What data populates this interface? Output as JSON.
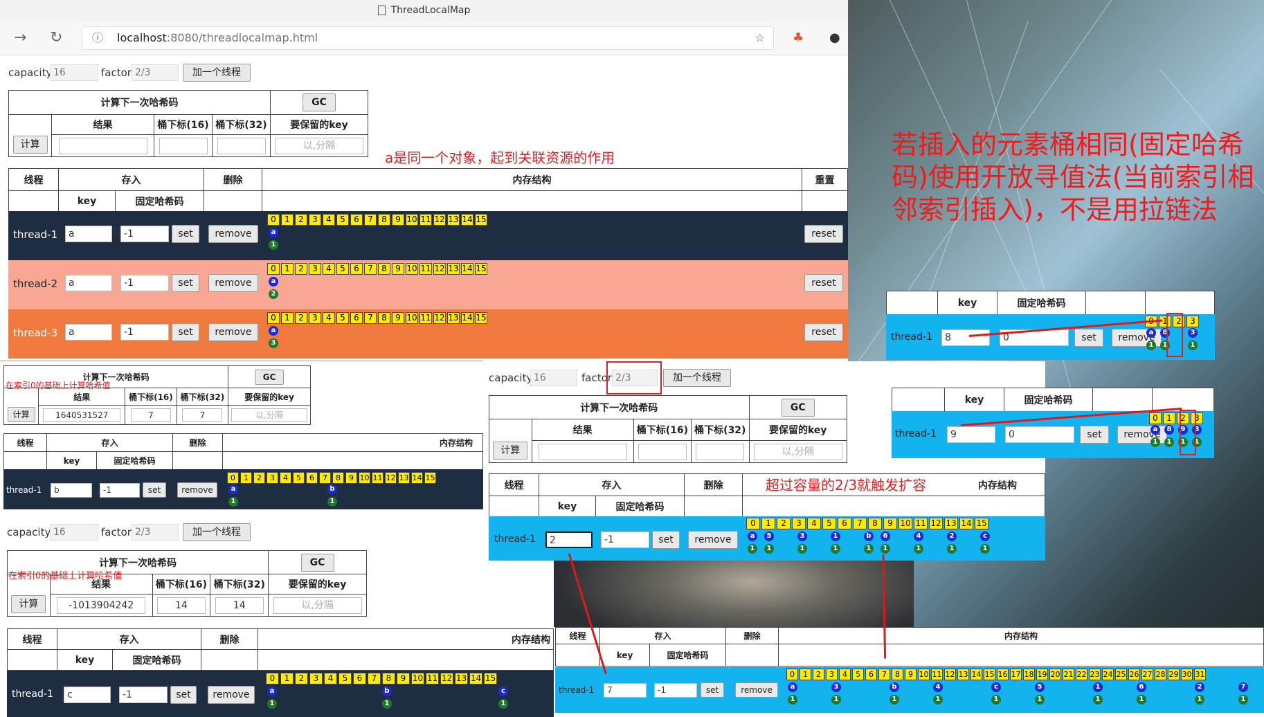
{
  "browser": {
    "tab_title": "ThreadLocalMap",
    "url_host": "localhost",
    "url_rest": ":8080/threadlocalmap.html"
  },
  "main": {
    "capacity_label": "capacity",
    "capacity_value": "16",
    "factor_label": "factor",
    "factor_value": "2/3",
    "add_thread_btn": "加一个线程",
    "calc_title": "计算下一次哈希码",
    "gc_btn": "GC",
    "result_label": "结果",
    "bucket16_label": "桶下标(16)",
    "bucket32_label": "桶下标(32)",
    "keep_key_label": "要保留的key",
    "calc_btn": "计算",
    "keep_placeholder": "以,分隔",
    "annotation": "a是同一个对象，起到关联资源的作用",
    "th_thread": "线程",
    "th_store": "存入",
    "th_delete": "删除",
    "th_memory": "内存结构",
    "th_reset": "重置",
    "th_key": "key",
    "th_fixed_hash": "固定哈希码",
    "set_btn": "set",
    "remove_btn": "remove",
    "reset_btn": "reset",
    "rows": [
      {
        "thread": "thread-1",
        "key": "a",
        "hash": "-1",
        "circle_key": "a",
        "circle_num": "1"
      },
      {
        "thread": "thread-2",
        "key": "a",
        "hash": "-1",
        "circle_key": "a",
        "circle_num": "2"
      },
      {
        "thread": "thread-3",
        "key": "a",
        "hash": "-1",
        "circle_key": "a",
        "circle_num": "3"
      }
    ]
  },
  "buckets16": [
    "0",
    "1",
    "2",
    "3",
    "4",
    "5",
    "6",
    "7",
    "8",
    "9",
    "10",
    "11",
    "12",
    "13",
    "14",
    "15"
  ],
  "buckets32": [
    "0",
    "1",
    "2",
    "3",
    "4",
    "5",
    "6",
    "7",
    "8",
    "9",
    "10",
    "11",
    "12",
    "13",
    "14",
    "15",
    "16",
    "17",
    "18",
    "19",
    "20",
    "21",
    "22",
    "23",
    "24",
    "25",
    "26",
    "27",
    "28",
    "29",
    "30",
    "31"
  ],
  "snippet_b": {
    "note": "在索引0的基础上计算哈希值",
    "result": "1640531527",
    "b16": "7",
    "b32": "7",
    "thread": "thread-1",
    "key": "b",
    "hash": "-1"
  },
  "snippet_c": {
    "capacity_value": "16",
    "factor_value": "2/3",
    "note": "在索引0的基础上计算哈希值",
    "result": "-1013904242",
    "b16": "14",
    "b32": "14",
    "thread": "thread-1",
    "key": "c",
    "hash": "-1"
  },
  "snippet_resize": {
    "capacity_value": "16",
    "factor_value": "2/3",
    "annotation": "超过容量的2/3就触发扩容",
    "thread": "thread-1",
    "key": "2",
    "hash": "-1"
  },
  "snippet_resized": {
    "thread": "thread-1",
    "key": "7",
    "hash": "-1"
  },
  "right": {
    "big_annotation": "若插入的元素桶相同(固定哈希码)使用开放寻值法(当前索引相邻索引插入)，不是用拉链法",
    "top_row": {
      "thread": "thread-1",
      "key": "8",
      "hash": "0"
    },
    "bottom_row": {
      "thread": "thread-1",
      "key": "9",
      "hash": "0"
    },
    "buckets": [
      "0",
      "1",
      "2",
      "3"
    ]
  }
}
